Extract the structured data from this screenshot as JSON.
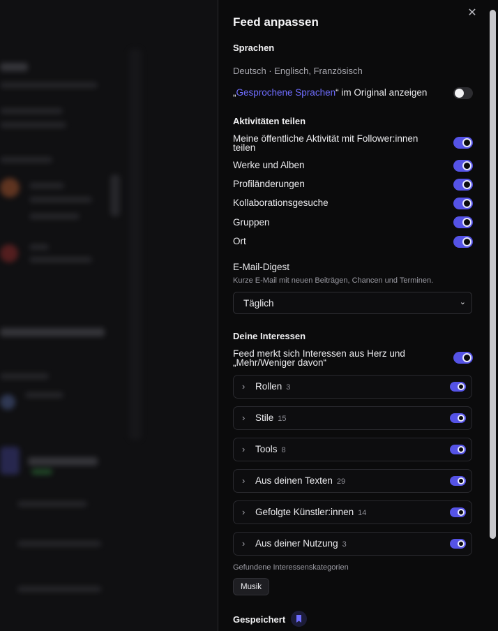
{
  "panel": {
    "title": "Feed anpassen",
    "languages": {
      "heading": "Sprachen",
      "value": "Deutsch · Englisch, Französisch",
      "show_original_prefix": "„",
      "show_original_link": "Gesprochene Sprachen",
      "show_original_suffix": "“ im Original anzeigen",
      "show_original_on": false
    },
    "activities": {
      "heading": "Aktivitäten teilen",
      "items": [
        {
          "label": "Meine öffentliche Aktivität mit Follower:innen teilen",
          "on": true
        },
        {
          "label": "Werke und Alben",
          "on": true
        },
        {
          "label": "Profiländerungen",
          "on": true
        },
        {
          "label": "Kollaborationsgesuche",
          "on": true
        },
        {
          "label": "Gruppen",
          "on": true
        },
        {
          "label": "Ort",
          "on": true
        }
      ]
    },
    "email_digest": {
      "label": "E-Mail-Digest",
      "hint": "Kurze E-Mail mit neuen Beiträgen, Chancen und Terminen.",
      "selected": "Täglich"
    },
    "interests": {
      "heading": "Deine Interessen",
      "remember_label": "Feed merkt sich Interessen aus Herz und „Mehr/Weniger davon“",
      "remember_on": true,
      "categories": [
        {
          "name": "Rollen",
          "count": "3",
          "on": true
        },
        {
          "name": "Stile",
          "count": "15",
          "on": true
        },
        {
          "name": "Tools",
          "count": "8",
          "on": true
        },
        {
          "name": "Aus deinen Texten",
          "count": "29",
          "on": true
        },
        {
          "name": "Gefolgte Künstler:innen",
          "count": "14",
          "on": true
        },
        {
          "name": "Aus deiner Nutzung",
          "count": "3",
          "on": true
        }
      ],
      "found_label": "Gefundene Interessenskategorien",
      "found_chips": [
        "Musik"
      ]
    },
    "saved": {
      "heading": "Gespeichert"
    }
  },
  "colors": {
    "accent": "#5553e6",
    "link": "#6f6dff",
    "panel_bg": "#0b0b0c"
  }
}
